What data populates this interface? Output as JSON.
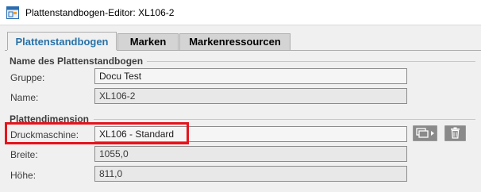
{
  "window": {
    "title": "Plattenstandbogen-Editor: XL106-2",
    "icon": "sheet-editor-icon"
  },
  "tabs": [
    {
      "label": "Plattenstandbogen",
      "active": true
    },
    {
      "label": "Marken",
      "active": false
    },
    {
      "label": "Markenressourcen",
      "active": false
    }
  ],
  "sections": {
    "name_section": {
      "title": "Name des Plattenstandbogen",
      "fields": {
        "gruppe": {
          "label": "Gruppe:",
          "value": "Docu Test"
        },
        "name": {
          "label": "Name:",
          "value": "XL106-2"
        }
      }
    },
    "dimension_section": {
      "title": "Plattendimension",
      "fields": {
        "druckmaschine": {
          "label": "Druckmaschine:",
          "value": "XL106 - Standard"
        },
        "breite": {
          "label": "Breite:",
          "value": "1055,0"
        },
        "hoehe": {
          "label": "Höhe:",
          "value": "811,0"
        }
      }
    }
  },
  "buttons": {
    "select_machine": {
      "icon": "select-dropdown-icon"
    },
    "delete": {
      "icon": "trash-icon"
    }
  },
  "colors": {
    "active_tab_text": "#2872a8",
    "highlight_border": "#e4141c",
    "icon_button_bg": "#8a8a8a"
  }
}
